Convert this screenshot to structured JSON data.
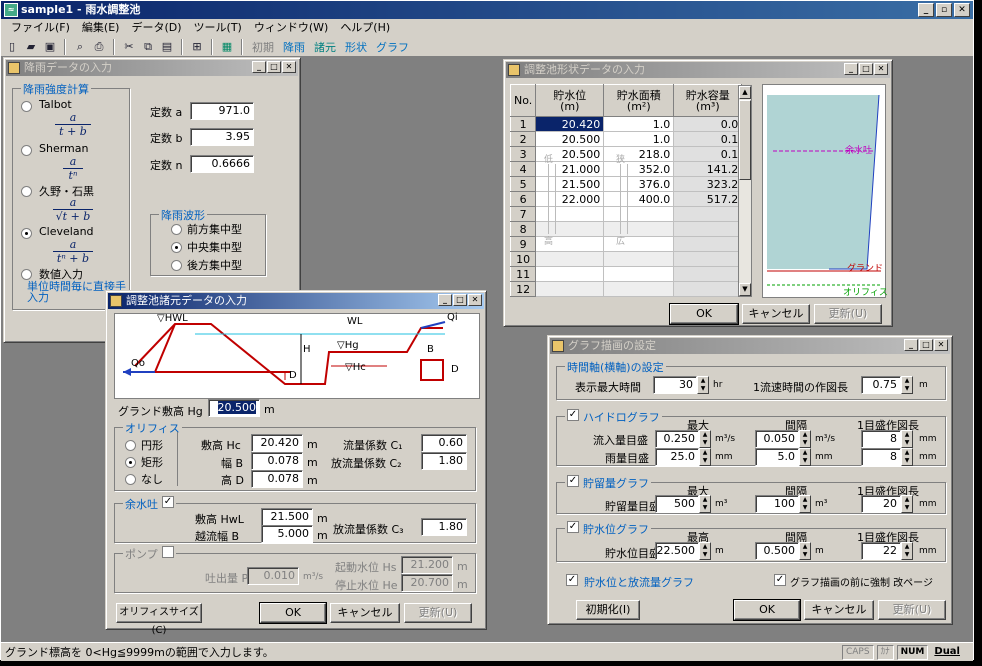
{
  "app": {
    "title": "sample1 - 雨水調整池",
    "menu": [
      "ファイル(F)",
      "編集(E)",
      "データ(D)",
      "ツール(T)",
      "ウィンドウ(W)",
      "ヘルプ(H)"
    ],
    "toolbar_text": [
      "初期",
      "降雨",
      "諸元",
      "形状",
      "グラフ"
    ],
    "status": "グランド標高を 0<Hg≦9999mの範囲で入力します。",
    "status_panes": [
      "CAPS",
      "ｶﾅ",
      "NUM",
      "Dual"
    ]
  },
  "rain": {
    "title": "降雨データの入力",
    "group": "降雨強度計算",
    "methods": [
      {
        "label": "Talbot",
        "num": "a",
        "den": "t + b"
      },
      {
        "label": "Sherman",
        "num": "a",
        "den": "tⁿ"
      },
      {
        "label": "久野・石黒",
        "num": "a",
        "den": "√t + b"
      },
      {
        "label": "Cleveland",
        "num": "a",
        "den": "tⁿ + b"
      }
    ],
    "direct": "数値入力",
    "direct_note": "単位時間毎に直接手入力",
    "const_a_label": "定数 a",
    "const_a": "971.0",
    "const_b_label": "定数 b",
    "const_b": "3.95",
    "const_n_label": "定数 n",
    "const_n": "0.6666",
    "wave_group": "降雨波形",
    "waves": [
      "前方集中型",
      "中央集中型",
      "後方集中型"
    ]
  },
  "spec": {
    "title": "調整池諸元データの入力",
    "diagram": {
      "hwl": "▽HWL",
      "wl": "WL",
      "hg": "▽Hg",
      "hc": "▽Hc",
      "qi": "Qi",
      "qo": "Qo",
      "h": "H",
      "d": "D",
      "b": "B"
    },
    "ground_label": "グランド敷高  Hg",
    "ground": "20.500",
    "m": "m",
    "orifice_group": "オリフィス",
    "shapes": [
      "円形",
      "矩形",
      "なし"
    ],
    "hc_label": "敷高 Hc",
    "hc": "20.420",
    "b_label": "幅 B",
    "b": "0.078",
    "d_label": "高 D",
    "d": "0.078",
    "c1_label": "流量係数 C₁",
    "c1": "0.60",
    "c2_label": "放流量係数 C₂",
    "c2": "1.80",
    "spill_group": "余水吐",
    "hwl_label": "敷高 HwL",
    "hwl": "21.500",
    "width_label": "越流幅 B",
    "width": "5.000",
    "c3_label": "放流量係数 C₃",
    "c3": "1.80",
    "pump_group": "ポンプ",
    "pump_p_label": "吐出量 P",
    "pump_p": "0.010",
    "pump_unit": "m³/s",
    "hs_label": "起動水位 Hs",
    "hs": "21.200",
    "he_label": "停止水位 He",
    "he": "20.700",
    "btn_orifice": "オリフィスサイズ(C)",
    "btn_ok": "OK",
    "btn_cancel": "キャンセル",
    "btn_update": "更新(U)"
  },
  "shape": {
    "title": "調整池形状データの入力",
    "headers": {
      "no": "No.",
      "level": "貯水位",
      "level_u": "(m)",
      "area": "貯水面積",
      "area_u": "(m²)",
      "vol": "貯水容量",
      "vol_u": "(m³)"
    },
    "rows": [
      {
        "no": "1",
        "level": "20.420",
        "area": "1.0",
        "vol": "0.0"
      },
      {
        "no": "2",
        "level": "20.500",
        "area": "1.0",
        "vol": "0.1"
      },
      {
        "no": "3",
        "level": "20.500",
        "area": "218.0",
        "vol": "0.1"
      },
      {
        "no": "4",
        "level": "21.000",
        "area": "352.0",
        "vol": "141.2"
      },
      {
        "no": "5",
        "level": "21.500",
        "area": "376.0",
        "vol": "323.2"
      },
      {
        "no": "6",
        "level": "22.000",
        "area": "400.0",
        "vol": "517.2"
      },
      {
        "no": "7",
        "level": "",
        "area": "",
        "vol": ""
      },
      {
        "no": "8",
        "level": "",
        "area": "",
        "vol": ""
      },
      {
        "no": "9",
        "level": "",
        "area": "",
        "vol": ""
      },
      {
        "no": "10",
        "level": "",
        "area": "",
        "vol": ""
      },
      {
        "no": "11",
        "level": "",
        "area": "",
        "vol": ""
      },
      {
        "no": "12",
        "level": "",
        "area": "",
        "vol": ""
      }
    ],
    "arrow_low": "低",
    "arrow_high": "高",
    "arrow_narrow": "狭",
    "arrow_wide": "広",
    "label_spill": "余水吐",
    "label_ground": "グランド",
    "label_orifice": "オリフィス",
    "btn_ok": "OK",
    "btn_cancel": "キャンセル",
    "btn_update": "更新(U)"
  },
  "graph": {
    "title": "グラフ描画の設定",
    "time_group": "時間軸(横軸)の設定",
    "max_time_label": "表示最大時間",
    "max_time": "30",
    "hr": "hr",
    "len_label": "1流速時間の作図長",
    "len": "0.75",
    "m": "m",
    "hydro_label": "ハイドログラフ",
    "max": "最大",
    "interval": "間隔",
    "len1": "1目盛作図長",
    "inflow_label": "流入量目盛",
    "inflow_max": "0.250",
    "inflow_unit": "m³/s",
    "inflow_int": "0.050",
    "inflow_len": "8",
    "mm": "mm",
    "rain_label": "雨量目盛",
    "rain_max": "25.0",
    "rain_int": "5.0",
    "rain_len": "8",
    "store_label": "貯留量グラフ",
    "store_tick_label": "貯留量目盛",
    "store_max": "500",
    "m3": "m³",
    "store_int": "100",
    "store_len": "20",
    "level_label": "貯水位グラフ",
    "highest": "最高",
    "level_tick_label": "貯水位目盛",
    "level_max": "22.500",
    "level_int": "0.500",
    "level_len": "22",
    "combo_label": "貯水位と放流量グラフ",
    "force_label": "グラフ描画の前に強制 改ページ",
    "btn_init": "初期化(I)",
    "btn_ok": "OK",
    "btn_cancel": "キャンセル",
    "btn_update": "更新(U)"
  }
}
